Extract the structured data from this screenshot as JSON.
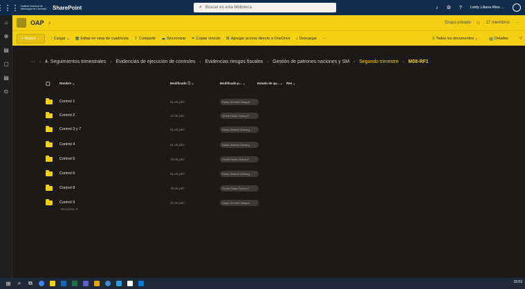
{
  "suitebar": {
    "org_name": "Instituto Nacional de Metrología de Colombia",
    "brand": "SharePoint",
    "search_placeholder": "Buscar en esta biblioteca",
    "user_name": "Leidy Liliana Rios ..."
  },
  "site": {
    "title": "OAP",
    "group_type": "Grupo privado",
    "members": "17 miembros"
  },
  "commands": {
    "new": "+ Nuevo ⌄",
    "upload": "Cargar ⌄",
    "grid": "Editar en vista de cuadrícula",
    "share": "Compartir",
    "sync": "Sincronizar",
    "copy_link": "Copiar vínculo",
    "shortcut": "Agregar acceso directo a OneDrive",
    "download": "Descargar",
    "more": "···",
    "all_docs": "Todos los documentos ⌄",
    "details": "Detalles"
  },
  "breadcrumb": [
    "4. Seguimientos trimestrales",
    "Evidencias de ejecución de controles",
    "Evidencias riesgos fiscales",
    "Gestión de patrones naciones y SM",
    "Segundo trimestre",
    "M08-RF1"
  ],
  "columns": {
    "name": "Nombre ⌄",
    "modified": "Modificado ⓘ ⌄",
    "modified_by": "Modificado p... ⌄",
    "state": "Estado de ap... ⌄",
    "rev": "Rev ⌄"
  },
  "rows": [
    {
      "name": "Control 1",
      "modified": "21 de julio",
      "modified_by": "Daisy Jenneth Vasque"
    },
    {
      "name": "Control 2",
      "modified": "18 de julio",
      "modified_by": "Yineth Paola Ochoa F"
    },
    {
      "name": "Control 3 y 7",
      "modified": "21 de julio",
      "modified_by": "Diana Jimena Camarg"
    },
    {
      "name": "Control 4",
      "modified": "21 de julio",
      "modified_by": "Diana Jimena Camarg"
    },
    {
      "name": "Control 5",
      "modified": "18 de julio",
      "modified_by": "Yineth Paola Ochoa F"
    },
    {
      "name": "Control 6",
      "modified": "21 de julio",
      "modified_by": "Diana Jimena Camarg"
    },
    {
      "name": "Control 8",
      "modified": "18 de julio",
      "modified_by": "Yineth Paola Ochoa F"
    },
    {
      "name": "Control 9",
      "modified": "22 de julio",
      "modified_by": "Daisy Jenneth Vasque"
    }
  ],
  "recuento": "Recuento: 8",
  "clock": {
    "time": "15:03"
  },
  "colors": {
    "accent": "#f4d013",
    "suitebar": "#0f2c4c"
  }
}
